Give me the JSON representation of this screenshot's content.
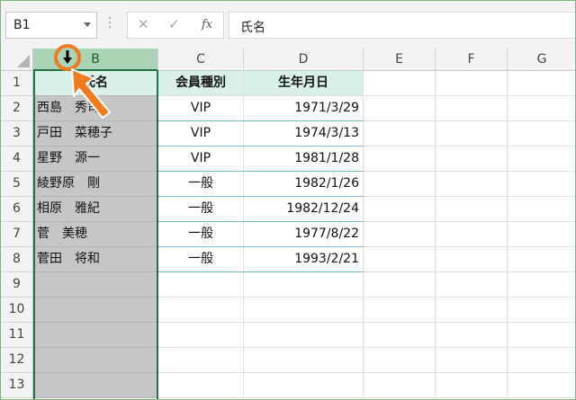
{
  "formula_bar": {
    "name_box": "B1",
    "cancel_icon": "✕",
    "enter_icon": "✓",
    "fx_label": "fx",
    "formula_value": "氏名"
  },
  "columns": [
    "B",
    "C",
    "D",
    "E",
    "F",
    "G"
  ],
  "rows": [
    "1",
    "2",
    "3",
    "4",
    "5",
    "6",
    "7",
    "8",
    "9",
    "10",
    "11",
    "12",
    "13"
  ],
  "table": {
    "headers": {
      "B": "氏名",
      "C": "会員種別",
      "D": "生年月日"
    },
    "records": [
      {
        "B": "西島　秀司",
        "C": "VIP",
        "D": "1971/3/29"
      },
      {
        "B": "戸田　菜穂子",
        "C": "VIP",
        "D": "1974/3/13"
      },
      {
        "B": "星野　源一",
        "C": "VIP",
        "D": "1981/1/28"
      },
      {
        "B": "綾野原　剛",
        "C": "一般",
        "D": "1982/1/26"
      },
      {
        "B": "相原　雅紀",
        "C": "一般",
        "D": "1982/12/24"
      },
      {
        "B": "菅　美穂",
        "C": "一般",
        "D": "1977/8/22"
      },
      {
        "B": "菅田　将和",
        "C": "一般",
        "D": "1993/2/21"
      }
    ]
  },
  "selected_column": "B",
  "colors": {
    "accent": "#217346",
    "annotation": "#f07b1f",
    "table_header": "#d9f0e9"
  },
  "icons": {
    "cursor": "down-arrow-cursor-icon",
    "annotation_arrow": "pointer-arrow-icon"
  }
}
